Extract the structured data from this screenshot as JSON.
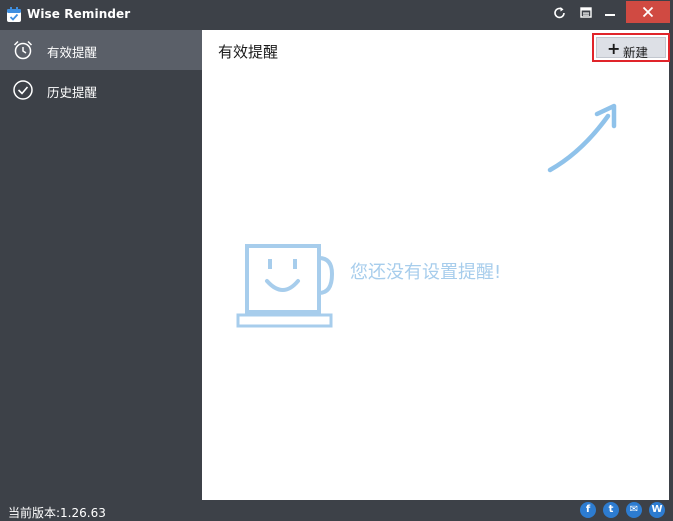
{
  "window": {
    "title": "Wise Reminder",
    "controls": {
      "refresh": "refresh-icon",
      "menu": "menu-icon",
      "minimize": "minimize-icon",
      "close": "close-icon"
    }
  },
  "sidebar": {
    "items": [
      {
        "label": "有效提醒",
        "icon": "alarm-clock-icon",
        "active": true
      },
      {
        "label": "历史提醒",
        "icon": "check-circle-icon",
        "active": false
      }
    ]
  },
  "main": {
    "title": "有效提醒",
    "new_button": {
      "plus": "+",
      "label": "新建"
    },
    "empty_message": "您还没有设置提醒!"
  },
  "statusbar": {
    "version": "当前版本:1.26.63",
    "social": [
      {
        "icon": "facebook-icon",
        "glyph": "f"
      },
      {
        "icon": "twitter-icon",
        "glyph": "t"
      },
      {
        "icon": "mail-icon",
        "glyph": "✉"
      },
      {
        "icon": "wise-icon",
        "glyph": "W"
      }
    ]
  },
  "colors": {
    "background": "#3d4148",
    "sidebar_active": "#5a5f68",
    "close_button": "#d04a42",
    "highlight_border": "#e0242a",
    "illustration": "#a7cdec",
    "social": "#2d7cd1"
  }
}
